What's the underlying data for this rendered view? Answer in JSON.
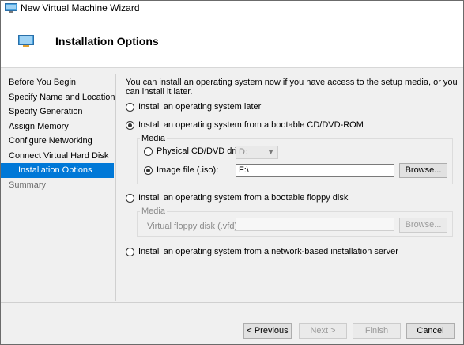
{
  "window": {
    "title": "New Virtual Machine Wizard"
  },
  "header": {
    "title": "Installation Options"
  },
  "nav": {
    "items": [
      {
        "label": "Before You Begin",
        "state": "normal"
      },
      {
        "label": "Specify Name and Location",
        "state": "normal"
      },
      {
        "label": "Specify Generation",
        "state": "normal"
      },
      {
        "label": "Assign Memory",
        "state": "normal"
      },
      {
        "label": "Configure Networking",
        "state": "normal"
      },
      {
        "label": "Connect Virtual Hard Disk",
        "state": "normal"
      },
      {
        "label": "Installation Options",
        "state": "active"
      },
      {
        "label": "Summary",
        "state": "disabled"
      }
    ]
  },
  "main": {
    "description": "You can install an operating system now if you have access to the setup media, or you can install it later.",
    "option_later": {
      "label": "Install an operating system later",
      "checked": false
    },
    "option_dvd": {
      "label": "Install an operating system from a bootable CD/DVD-ROM",
      "checked": true
    },
    "dvd_media": {
      "group_label": "Media",
      "physical_label": "Physical CD/DVD drive:",
      "physical_checked": false,
      "physical_value": "D:",
      "image_label": "Image file (.iso):",
      "image_checked": true,
      "image_value": "F:\\",
      "browse_label": "Browse..."
    },
    "option_floppy": {
      "label": "Install an operating system from a bootable floppy disk",
      "checked": false
    },
    "floppy_media": {
      "group_label": "Media",
      "vfd_label": "Virtual floppy disk (.vfd):",
      "vfd_value": "",
      "browse_label": "Browse..."
    },
    "option_network": {
      "label": "Install an operating system from a network-based installation server",
      "checked": false
    }
  },
  "footer": {
    "previous_label": "< Previous",
    "next_label": "Next >",
    "finish_label": "Finish",
    "cancel_label": "Cancel"
  },
  "colors": {
    "accent": "#0078d7",
    "disabled_text": "#8a8a8a"
  }
}
